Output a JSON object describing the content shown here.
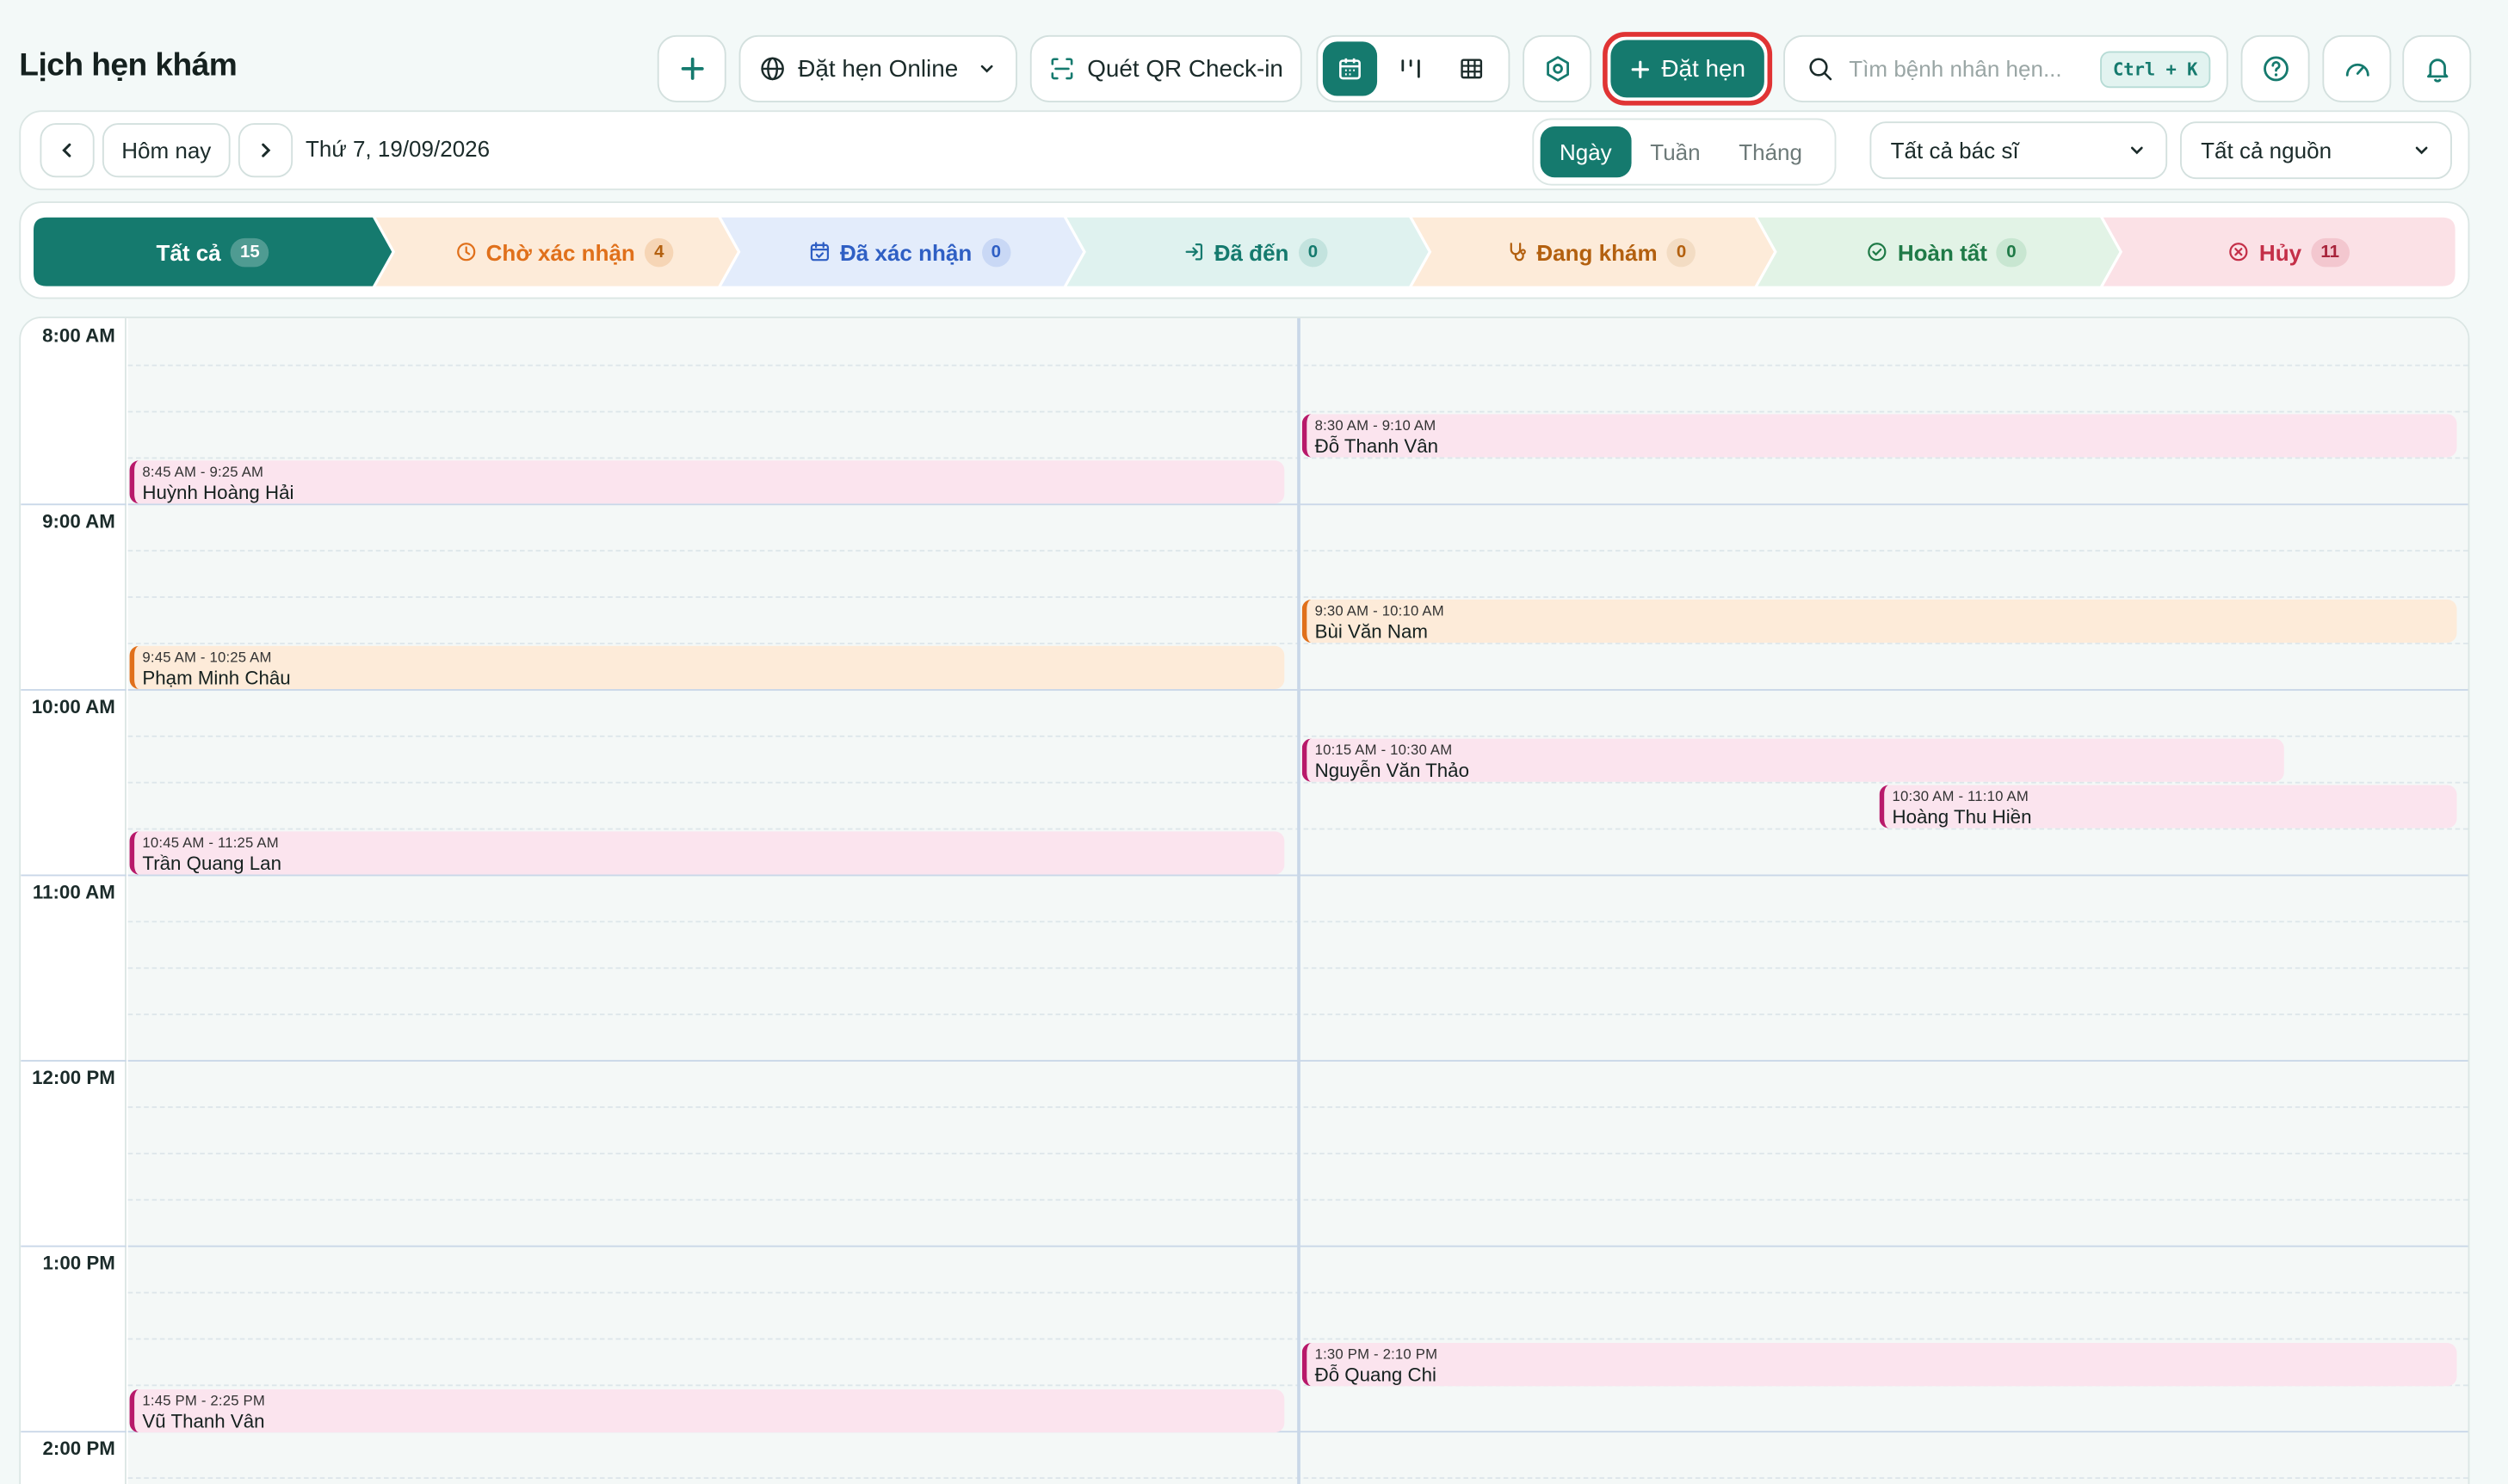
{
  "header": {
    "title": "Lịch hẹn khám",
    "online_booking": "Đặt hẹn Online",
    "qr_checkin": "Quét QR Check-in",
    "new_appointment": "Đặt hẹn",
    "search_placeholder": "Tìm bệnh nhân hẹn...",
    "search_shortcut": "Ctrl + K"
  },
  "toolbar": {
    "today": "Hôm nay",
    "date": "Thứ 7, 19/09/2026",
    "views": [
      "Ngày",
      "Tuần",
      "Tháng"
    ],
    "active_view": "Ngày",
    "doctor_filter": "Tất cả bác sĩ",
    "source_filter": "Tất cả nguồn"
  },
  "status_tabs": [
    {
      "label": "Tất cả",
      "count": "15",
      "color": "#157a6e"
    },
    {
      "label": "Chờ xác nhận",
      "count": "4",
      "color": "#e0701b"
    },
    {
      "label": "Đã xác nhận",
      "count": "0",
      "color": "#2f5fc4"
    },
    {
      "label": "Đã đến",
      "count": "0",
      "color": "#157a6e"
    },
    {
      "label": "Đang khám",
      "count": "0",
      "color": "#b3600f"
    },
    {
      "label": "Hoàn tất",
      "count": "0",
      "color": "#1f7a47"
    },
    {
      "label": "Hủy",
      "count": "11",
      "color": "#c42f48"
    }
  ],
  "time_labels": [
    "8:00 AM",
    "9:00 AM",
    "10:00 AM",
    "11:00 AM",
    "12:00 PM",
    "1:00 PM",
    "2:00 PM"
  ],
  "appointments": [
    {
      "time": "8:45 AM - 9:25 AM",
      "name": "Huỳnh Hoàng Hải"
    },
    {
      "time": "8:30 AM - 9:10 AM",
      "name": "Đỗ Thanh Vân"
    },
    {
      "time": "9:45 AM - 10:25 AM",
      "name": "Phạm Minh Châu"
    },
    {
      "time": "9:30 AM - 10:10 AM",
      "name": "Bùi Văn Nam"
    },
    {
      "time": "10:15 AM - 10:30 AM",
      "name": "Nguyễn Văn Thảo"
    },
    {
      "time": "10:30 AM - 11:10 AM",
      "name": "Hoàng Thu Hiền"
    },
    {
      "time": "10:45 AM - 11:25 AM",
      "name": "Trần Quang Lan"
    },
    {
      "time": "1:30 PM - 2:10 PM",
      "name": "Đỗ Quang Chi"
    },
    {
      "time": "1:45 PM - 2:25 PM",
      "name": "Vũ Thanh Vân"
    }
  ]
}
